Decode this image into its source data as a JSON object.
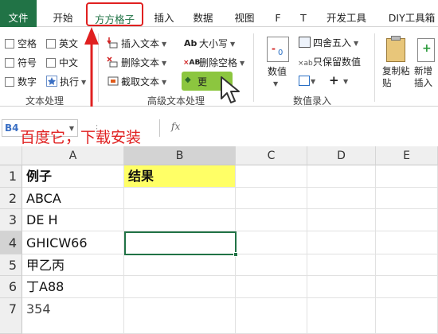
{
  "tabs": [
    {
      "label": "文件"
    },
    {
      "label": "开始"
    },
    {
      "label": "方方格子"
    },
    {
      "label": "插入"
    },
    {
      "label": "数据"
    },
    {
      "label": "视图"
    },
    {
      "label": "F"
    },
    {
      "label": "T"
    },
    {
      "label": "开发工具"
    },
    {
      "label": "DIY工具箱"
    }
  ],
  "ribbon": {
    "text_processing": {
      "checkboxes": [
        "空格",
        "英文",
        "符号",
        "中文",
        "数字"
      ],
      "execute": "执行",
      "group_label": "文本处理"
    },
    "advanced": {
      "insert_text": "插入文本",
      "delete_text": "删除文本",
      "extract_text": "截取文本",
      "case": "大小写",
      "delete_spaces": "删除空格",
      "more": "更",
      "group_label": "高级文本处理"
    },
    "numeric": {
      "value": "数值",
      "round": "四舍五入",
      "keep_value": "只保留数值",
      "group_label": "数值录入"
    },
    "copy_paste": "复制粘贴",
    "new_insert": "新增插入"
  },
  "formula_bar": {
    "name_box": "B4",
    "fx": "fx",
    "value": ""
  },
  "annotation": "百度它，下载安装",
  "sheet": {
    "columns": [
      "A",
      "B",
      "C",
      "D",
      "E"
    ],
    "rows": [
      {
        "num": "1",
        "a": "例子",
        "b": "结果"
      },
      {
        "num": "2",
        "a": "ABCA",
        "b": ""
      },
      {
        "num": "3",
        "a": "DE H",
        "b": ""
      },
      {
        "num": "4",
        "a": "GHICW66",
        "b": ""
      },
      {
        "num": "5",
        "a": "甲乙丙",
        "b": ""
      },
      {
        "num": "6",
        "a": "丁A88",
        "b": ""
      },
      {
        "num": "7",
        "a": "354",
        "b": ""
      }
    ]
  },
  "colors": {
    "accent_green": "#217346",
    "highlight_yellow": "#ffff66",
    "annotation_red": "#e02020",
    "selection_green": "#217346"
  }
}
